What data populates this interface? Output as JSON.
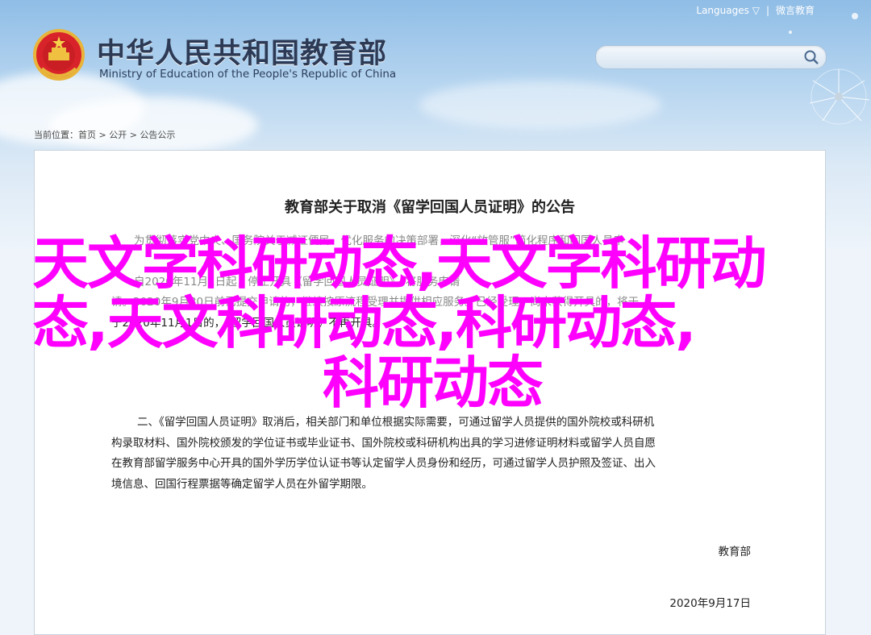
{
  "header": {
    "lang_label": "Languages",
    "lang_arrow": "▽",
    "separator": "|",
    "weibo_label": "微言教育",
    "title_cn": "中华人民共和国教育部",
    "title_en": "Ministry of Education of the People's Republic of China",
    "search_placeholder": ""
  },
  "breadcrumb": {
    "prefix": "当前位置：",
    "items": [
      "首页",
      "公开",
      "公告公示"
    ],
    "sep": " > "
  },
  "article": {
    "title": "教育部关于取消《留学回国人员证明》的公告",
    "para1_line1": "为贯彻落实党中央、国务院关于减证便民、优化服务的决策部署，深化“放管服”简化程序和回国人员申",
    "para1_line2": "",
    "para1_line3": "自2020年11月1日起，停止开具《留学回国人员证明》，将服务申请",
    "para1_line4": "请。2020年9月30日前已提交申请的，继续按原流程受理并提供相应服务。已经受理、尚未获得开具的，将于",
    "para1_line5": "于2020年11月1日的，《留学回国人员证明》不再开具。",
    "para2": [
      "二、《留学回国人员证明》取消后，相关部门和单位根据实际需要，可通过留学人员提供的国外院校或科研机",
      "构录取材料、国外院校颁发的学位证书或毕业证书、国外院校或科研机构出具的学习进修证明材料或留学人员自愿",
      "在教育部留学服务中心开具的国外学历学位认证书等认定留学人员身份和经历，可通过留学人员护照及签证、出入",
      "境信息、回国行程票据等确定留学人员在外留学期限。"
    ],
    "signature": "教育部",
    "date": "2020年9月17日"
  },
  "overlay": {
    "line1": "天文学科研动态,天文学科研动",
    "line2": "态,天文科研动态,科研动态,",
    "line3": "科研动态"
  },
  "colors": {
    "overlay": "#ff00ff",
    "title": "#2d3a55"
  }
}
